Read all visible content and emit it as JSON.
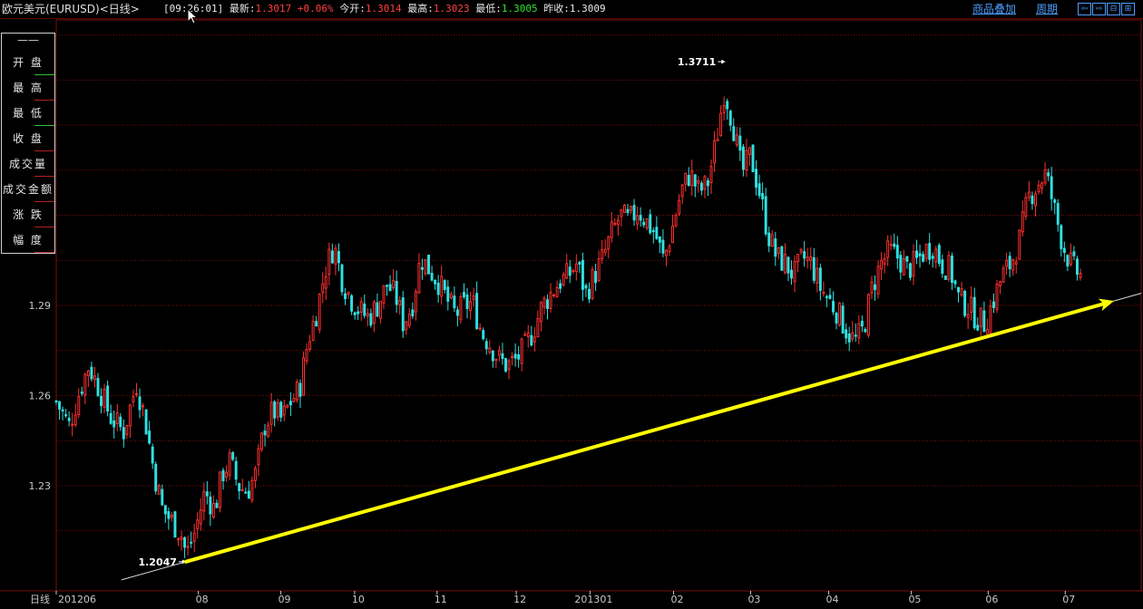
{
  "header": {
    "title": "欧元美元(EURUSD)<日线>",
    "time": "[09:26:01]",
    "latest_label": "最新:",
    "latest_value": "1.3017",
    "change": "+0.06%",
    "open_label": "今开:",
    "open_value": "1.3014",
    "high_label": "最高:",
    "high_value": "1.3023",
    "low_label": "最低:",
    "low_value": "1.3005",
    "prev_label": "昨收:",
    "prev_value": "1.3009",
    "overlay_link": "商品叠加",
    "period_link": "周期",
    "nav_prev": "⇦",
    "nav_next": "⇨",
    "nav_zoom": "⊟",
    "nav_full": "⊞"
  },
  "legend": {
    "dash": "——",
    "items": [
      "开 盘",
      "最 高",
      "最 低",
      "收 盘",
      "成交量",
      "成交金额",
      "涨 跌",
      "幅 度"
    ]
  },
  "colors": {
    "up": "#ff3030",
    "down": "#30e0e0",
    "grid": "#7a1010",
    "trend": "#ffff00",
    "frame": "#7a1010"
  },
  "chart_data": {
    "type": "candlestick",
    "period_label": "日线",
    "x_ticks": [
      "201206",
      "08",
      "09",
      "10",
      "11",
      "12",
      "201301",
      "02",
      "03",
      "04",
      "05",
      "06",
      "07"
    ],
    "y_ticks": [
      1.23,
      1.26,
      1.29
    ],
    "ylim": [
      1.195,
      1.385
    ],
    "annotations": [
      {
        "label": "1.3711",
        "value": 1.3711,
        "at": "high",
        "x_frac": 0.6165
      },
      {
        "label": "1.2047",
        "value": 1.2047,
        "at": "low",
        "x_frac": 0.1195
      }
    ],
    "trendline": {
      "from": {
        "x_frac": 0.1195,
        "value": 1.2047
      },
      "to": {
        "x_frac": 0.975,
        "value": 1.2915
      }
    },
    "close_path": [
      [
        0.0,
        1.258
      ],
      [
        0.012,
        1.25
      ],
      [
        0.022,
        1.262
      ],
      [
        0.03,
        1.27
      ],
      [
        0.04,
        1.262
      ],
      [
        0.05,
        1.253
      ],
      [
        0.062,
        1.248
      ],
      [
        0.074,
        1.264
      ],
      [
        0.082,
        1.252
      ],
      [
        0.09,
        1.235
      ],
      [
        0.098,
        1.222
      ],
      [
        0.107,
        1.218
      ],
      [
        0.115,
        1.214
      ],
      [
        0.12,
        1.207
      ],
      [
        0.128,
        1.215
      ],
      [
        0.137,
        1.228
      ],
      [
        0.146,
        1.222
      ],
      [
        0.153,
        1.234
      ],
      [
        0.16,
        1.238
      ],
      [
        0.168,
        1.23
      ],
      [
        0.176,
        1.228
      ],
      [
        0.184,
        1.234
      ],
      [
        0.192,
        1.25
      ],
      [
        0.2,
        1.255
      ],
      [
        0.208,
        1.252
      ],
      [
        0.216,
        1.258
      ],
      [
        0.224,
        1.262
      ],
      [
        0.232,
        1.278
      ],
      [
        0.24,
        1.288
      ],
      [
        0.248,
        1.302
      ],
      [
        0.256,
        1.31
      ],
      [
        0.264,
        1.298
      ],
      [
        0.272,
        1.292
      ],
      [
        0.28,
        1.288
      ],
      [
        0.288,
        1.286
      ],
      [
        0.296,
        1.29
      ],
      [
        0.305,
        1.297
      ],
      [
        0.313,
        1.293
      ],
      [
        0.32,
        1.284
      ],
      [
        0.328,
        1.29
      ],
      [
        0.336,
        1.306
      ],
      [
        0.344,
        1.302
      ],
      [
        0.352,
        1.298
      ],
      [
        0.36,
        1.292
      ],
      [
        0.368,
        1.287
      ],
      [
        0.376,
        1.29
      ],
      [
        0.384,
        1.291
      ],
      [
        0.392,
        1.281
      ],
      [
        0.4,
        1.277
      ],
      [
        0.408,
        1.272
      ],
      [
        0.416,
        1.27
      ],
      [
        0.424,
        1.272
      ],
      [
        0.432,
        1.276
      ],
      [
        0.44,
        1.282
      ],
      [
        0.448,
        1.29
      ],
      [
        0.456,
        1.294
      ],
      [
        0.464,
        1.298
      ],
      [
        0.472,
        1.3
      ],
      [
        0.48,
        1.304
      ],
      [
        0.488,
        1.294
      ],
      [
        0.496,
        1.3
      ],
      [
        0.504,
        1.306
      ],
      [
        0.512,
        1.314
      ],
      [
        0.52,
        1.32
      ],
      [
        0.528,
        1.318
      ],
      [
        0.536,
        1.322
      ],
      [
        0.544,
        1.318
      ],
      [
        0.552,
        1.314
      ],
      [
        0.56,
        1.305
      ],
      [
        0.568,
        1.316
      ],
      [
        0.576,
        1.328
      ],
      [
        0.584,
        1.334
      ],
      [
        0.592,
        1.328
      ],
      [
        0.6,
        1.33
      ],
      [
        0.608,
        1.344
      ],
      [
        0.616,
        1.362
      ],
      [
        0.624,
        1.35
      ],
      [
        0.632,
        1.334
      ],
      [
        0.64,
        1.34
      ],
      [
        0.648,
        1.328
      ],
      [
        0.656,
        1.314
      ],
      [
        0.664,
        1.306
      ],
      [
        0.672,
        1.304
      ],
      [
        0.68,
        1.3
      ],
      [
        0.688,
        1.306
      ],
      [
        0.696,
        1.304
      ],
      [
        0.704,
        1.296
      ],
      [
        0.712,
        1.292
      ],
      [
        0.72,
        1.288
      ],
      [
        0.728,
        1.282
      ],
      [
        0.736,
        1.278
      ],
      [
        0.744,
        1.282
      ],
      [
        0.752,
        1.296
      ],
      [
        0.76,
        1.304
      ],
      [
        0.768,
        1.308
      ],
      [
        0.776,
        1.306
      ],
      [
        0.784,
        1.302
      ],
      [
        0.792,
        1.304
      ],
      [
        0.8,
        1.308
      ],
      [
        0.808,
        1.31
      ],
      [
        0.816,
        1.304
      ],
      [
        0.824,
        1.302
      ],
      [
        0.832,
        1.292
      ],
      [
        0.84,
        1.29
      ],
      [
        0.848,
        1.286
      ],
      [
        0.856,
        1.284
      ],
      [
        0.864,
        1.292
      ],
      [
        0.872,
        1.3
      ],
      [
        0.88,
        1.304
      ],
      [
        0.888,
        1.312
      ],
      [
        0.896,
        1.326
      ],
      [
        0.904,
        1.33
      ],
      [
        0.912,
        1.334
      ],
      [
        0.92,
        1.322
      ],
      [
        0.928,
        1.31
      ],
      [
        0.936,
        1.303
      ],
      [
        0.944,
        1.3
      ]
    ]
  }
}
